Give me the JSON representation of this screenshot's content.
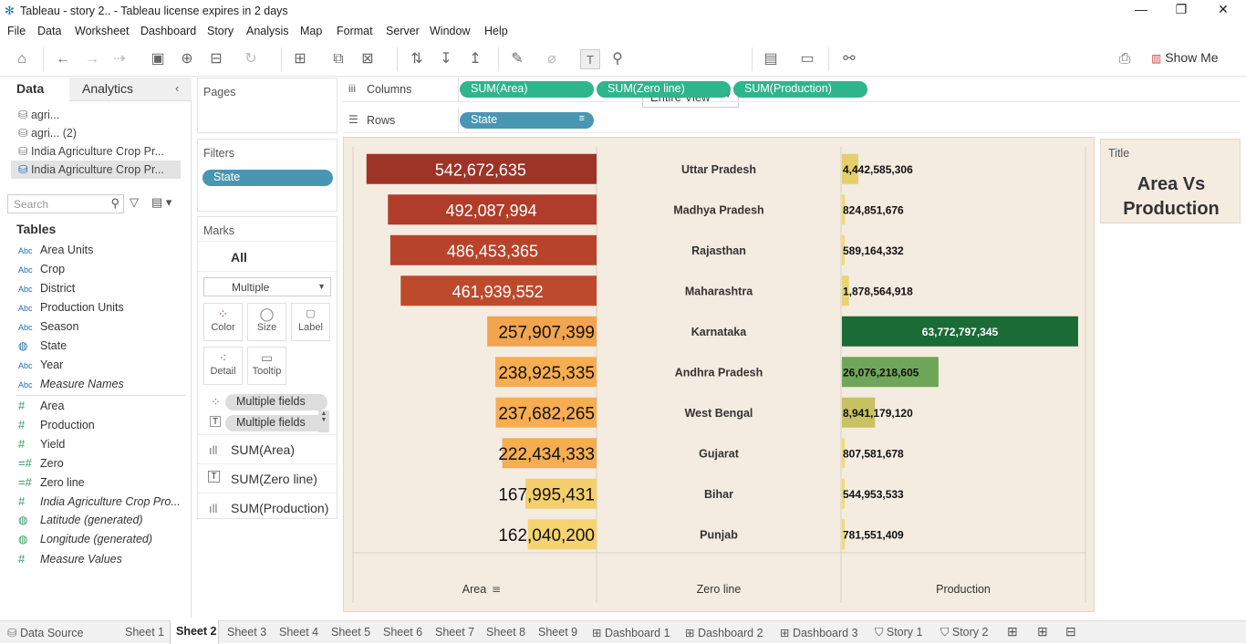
{
  "window": {
    "title": "Tableau - story 2.. - Tableau license expires in 2 days"
  },
  "menu": [
    "File",
    "Data",
    "Worksheet",
    "Dashboard",
    "Story",
    "Analysis",
    "Map",
    "Format",
    "Server",
    "Window",
    "Help"
  ],
  "toolbar": {
    "fit": "Entire View",
    "show_me": "Show Me"
  },
  "left": {
    "tab_data": "Data",
    "tab_analytics": "Analytics",
    "sources": [
      "agri...",
      "agri... (2)",
      "India Agriculture Crop Pr...",
      "India Agriculture Crop Pr..."
    ],
    "search_placeholder": "Search",
    "tables_label": "Tables",
    "dimensions": [
      {
        "name": "Area Units",
        "type": "Abc"
      },
      {
        "name": "Crop",
        "type": "Abc"
      },
      {
        "name": "District",
        "type": "Abc"
      },
      {
        "name": "Production Units",
        "type": "Abc"
      },
      {
        "name": "Season",
        "type": "Abc"
      },
      {
        "name": "State",
        "type": "globe"
      },
      {
        "name": "Year",
        "type": "Abc"
      },
      {
        "name": "Measure Names",
        "type": "Abc"
      }
    ],
    "measures": [
      {
        "name": "Area",
        "type": "#"
      },
      {
        "name": "Production",
        "type": "#"
      },
      {
        "name": "Yield",
        "type": "#"
      },
      {
        "name": "Zero",
        "type": "=#"
      },
      {
        "name": "Zero line",
        "type": "=#"
      },
      {
        "name": "India Agriculture Crop Pro...",
        "type": "#"
      },
      {
        "name": "Latitude (generated)",
        "type": "globe"
      },
      {
        "name": "Longitude (generated)",
        "type": "globe"
      },
      {
        "name": "Measure Values",
        "type": "#"
      }
    ]
  },
  "cards": {
    "pages": "Pages",
    "filters": "Filters",
    "filter_pill": "State",
    "marks": "Marks",
    "marks_all": "All",
    "mark_type": "Multiple",
    "buttons": [
      "Color",
      "Size",
      "Label",
      "Detail",
      "Tooltip"
    ],
    "mark_fields": [
      "Multiple fields",
      "Multiple fields"
    ],
    "mark_tabs": [
      "SUM(Area)",
      "SUM(Zero line)",
      "SUM(Production)"
    ]
  },
  "shelves": {
    "columns_label": "Columns",
    "columns": [
      "SUM(Area)",
      "SUM(Zero line)",
      "SUM(Production)"
    ],
    "rows_label": "Rows",
    "rows": [
      "State"
    ]
  },
  "title_card": {
    "label": "Title",
    "text_line1": "Area Vs",
    "text_line2": "Production"
  },
  "chart_data": {
    "type": "bar",
    "categories": [
      "Uttar Pradesh",
      "Madhya Pradesh",
      "Rajasthan",
      "Maharashtra",
      "Karnataka",
      "Andhra Pradesh",
      "West Bengal",
      "Gujarat",
      "Bihar",
      "Punjab"
    ],
    "series": [
      {
        "name": "Area",
        "values": [
          542672635,
          492087994,
          486453365,
          461939552,
          257907399,
          238925335,
          237682265,
          222434333,
          167995431,
          162040200
        ],
        "labels": [
          "542,672,635",
          "492,087,994",
          "486,453,365",
          "461,939,552",
          "257,907,399",
          "238,925,335",
          "237,682,265",
          "222,434,333",
          "167,995,431",
          "162,040,200"
        ]
      },
      {
        "name": "Production",
        "values": [
          4442585306,
          824851676,
          589164332,
          1878564918,
          63772797345,
          26076218605,
          8941179120,
          807581678,
          544953533,
          781551409
        ],
        "labels": [
          "4,442,585,306",
          "824,851,676",
          "589,164,332",
          "1,878,564,918",
          "63,772,797,345",
          "26,076,218,605",
          "8,941,179,120",
          "807,581,678",
          "544,953,533",
          "781,551,409"
        ]
      }
    ],
    "xlabels": [
      "Area",
      "Zero line",
      "Production"
    ],
    "area_colors": [
      "#9e3327",
      "#b03d2a",
      "#b8432b",
      "#bd4a2c",
      "#f2a54e",
      "#f7ad52",
      "#f7ad52",
      "#f7ad52",
      "#f5cf6c",
      "#f5d36f"
    ],
    "prod_colors": [
      "#e4cf6a",
      "#eddb7c",
      "#eddb7c",
      "#e8d474",
      "#1a6b36",
      "#6fa659",
      "#c8c262",
      "#eddb7c",
      "#eddb7c",
      "#eddb7c"
    ]
  },
  "bottom_tabs": [
    "Data Source",
    "Sheet 1",
    "Sheet 2",
    "Sheet 3",
    "Sheet 4",
    "Sheet 5",
    "Sheet 6",
    "Sheet 7",
    "Sheet 8",
    "Sheet 9",
    "Dashboard 1",
    "Dashboard 2",
    "Dashboard 3",
    "Story 1",
    "Story 2"
  ]
}
